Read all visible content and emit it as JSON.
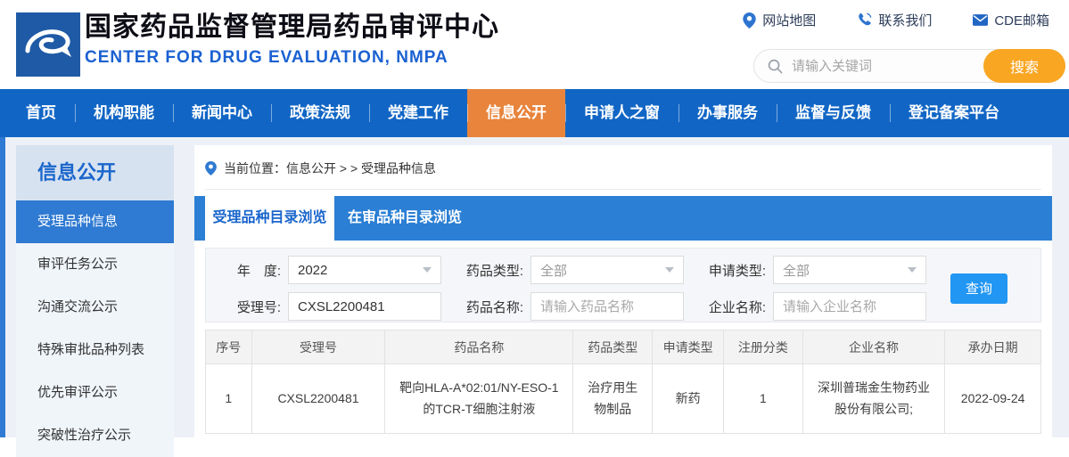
{
  "header": {
    "title": "国家药品监督管理局药品审评中心",
    "subtitle": "CENTER FOR DRUG EVALUATION, NMPA",
    "quick_links": [
      {
        "label": "网站地图",
        "icon": "location-pin-icon"
      },
      {
        "label": "联系我们",
        "icon": "phone-icon"
      },
      {
        "label": "CDE邮箱",
        "icon": "mail-icon"
      }
    ],
    "search": {
      "placeholder": "请输入关键词",
      "button_label": "搜索"
    }
  },
  "nav": {
    "items": [
      {
        "label": "首页",
        "active": false
      },
      {
        "label": "机构职能",
        "active": false
      },
      {
        "label": "新闻中心",
        "active": false
      },
      {
        "label": "政策法规",
        "active": false
      },
      {
        "label": "党建工作",
        "active": false
      },
      {
        "label": "信息公开",
        "active": true
      },
      {
        "label": "申请人之窗",
        "active": false
      },
      {
        "label": "办事服务",
        "active": false
      },
      {
        "label": "监督与反馈",
        "active": false
      },
      {
        "label": "登记备案平台",
        "active": false
      }
    ]
  },
  "sidebar": {
    "title": "信息公开",
    "items": [
      {
        "label": "受理品种信息",
        "active": true
      },
      {
        "label": "审评任务公示",
        "active": false
      },
      {
        "label": "沟通交流公示",
        "active": false
      },
      {
        "label": "特殊审批品种列表",
        "active": false
      },
      {
        "label": "优先审评公示",
        "active": false
      },
      {
        "label": "突破性治疗公示",
        "active": false
      }
    ]
  },
  "breadcrumb": {
    "text": "当前位置：信息公开 > > 受理品种信息"
  },
  "tabs": [
    {
      "label": "受理品种目录浏览",
      "active": true
    },
    {
      "label": "在审品种目录浏览",
      "active": false
    }
  ],
  "filters": {
    "year": {
      "label": "年　度:",
      "value": "2022"
    },
    "drug_type": {
      "label": "药品类型:",
      "value": "全部"
    },
    "apply_type": {
      "label": "申请类型:",
      "value": "全部"
    },
    "acceptance_no": {
      "label": "受理号:",
      "value": "CXSL2200481"
    },
    "drug_name": {
      "label": "药品名称:",
      "placeholder": "请输入药品名称"
    },
    "company_name": {
      "label": "企业名称:",
      "placeholder": "请输入企业名称"
    },
    "query_button": "查询"
  },
  "table": {
    "headers": [
      "序号",
      "受理号",
      "药品名称",
      "药品类型",
      "申请类型",
      "注册分类",
      "企业名称",
      "承办日期"
    ],
    "rows": [
      {
        "no": "1",
        "acceptance_no": "CXSL2200481",
        "drug_name": "靶向HLA-A*02:01/NY-ESO-1的TCR-T细胞注射液",
        "drug_type": "治疗用生物制品",
        "apply_type": "新药",
        "reg_class": "1",
        "company": "深圳普瑞金生物药业股份有限公司;",
        "date": "2022-09-24"
      }
    ]
  },
  "colors": {
    "nav_blue": "#1166c5",
    "nav_active_orange": "#e8843c",
    "accent_blue": "#2f7ad2",
    "search_orange": "#f9a623",
    "query_blue": "#2196f3",
    "subtitle_blue": "#1b61d1"
  }
}
